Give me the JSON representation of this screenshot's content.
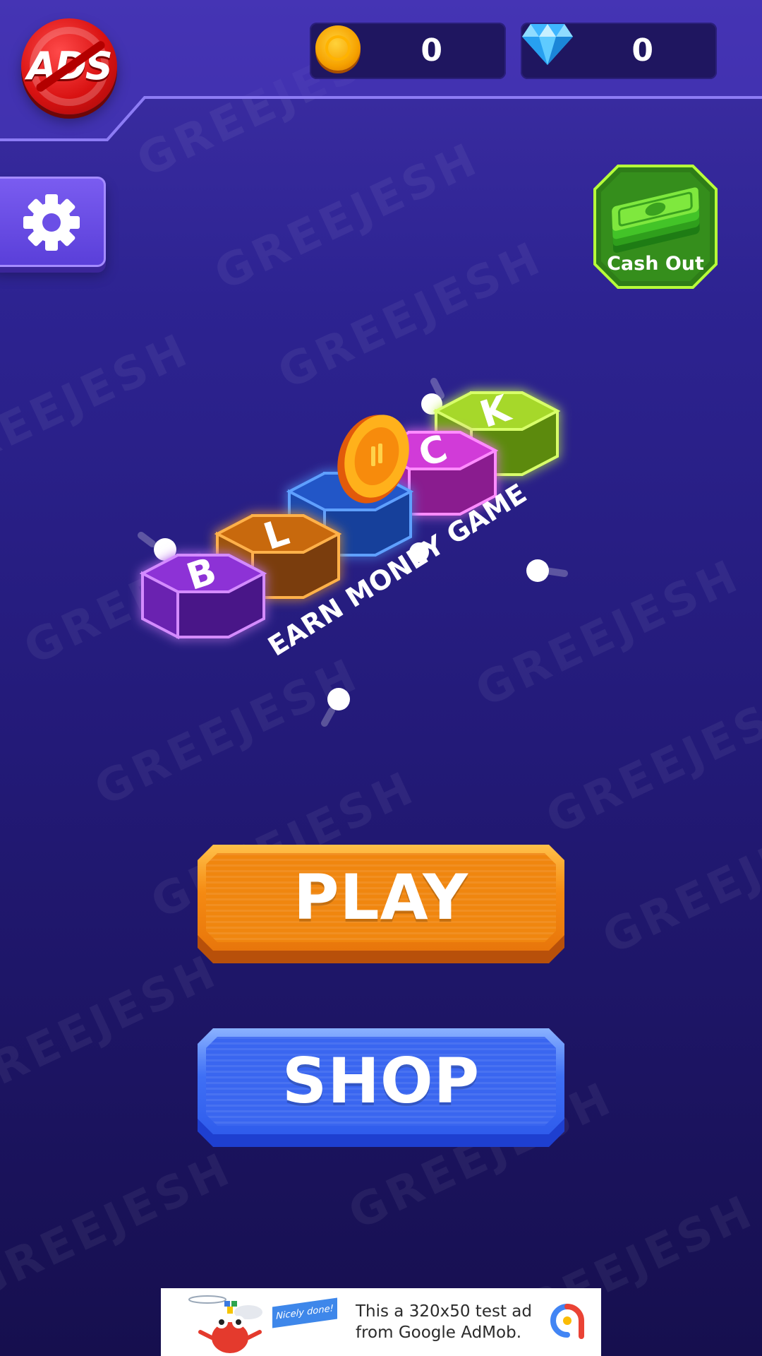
{
  "header": {
    "ads_label": "ADS",
    "coins": "0",
    "gems": "0"
  },
  "cashout": {
    "label": "Cash Out"
  },
  "logo": {
    "letters": [
      "B",
      "L",
      "C",
      "K"
    ],
    "tagline": "EARN MONEY GAME"
  },
  "buttons": {
    "play": "PLAY",
    "shop": "SHOP"
  },
  "ad": {
    "tag": "Nicely done!",
    "text": "This a 320x50 test ad from Google AdMob."
  },
  "watermark": "GREEJESH",
  "colors": {
    "play": "#f58a12",
    "shop": "#3f6ff5",
    "cashout_border": "#b7ff3a",
    "background": "#2d2391"
  }
}
